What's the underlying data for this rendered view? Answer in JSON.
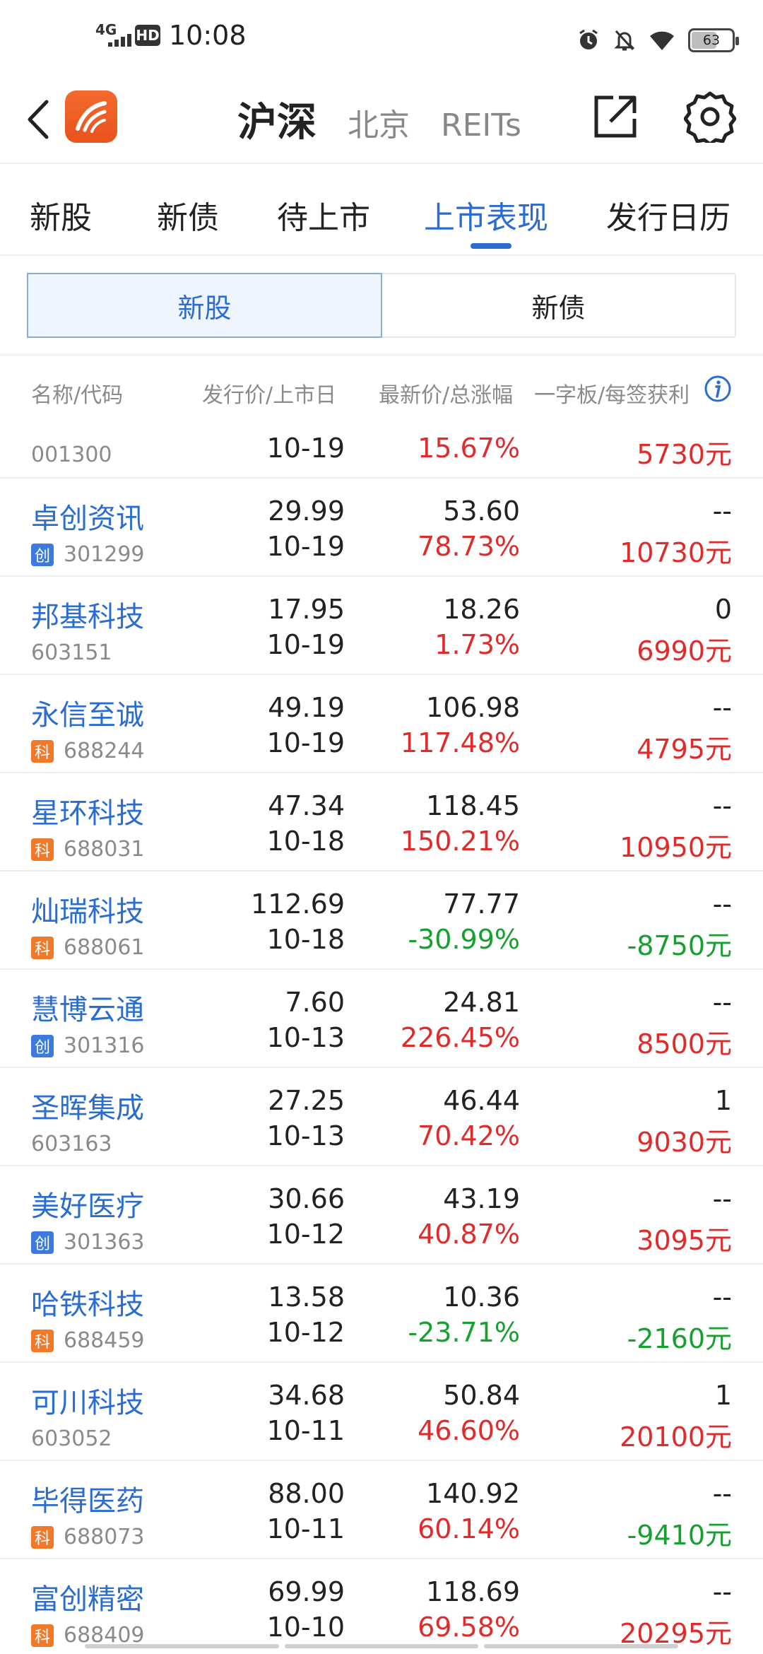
{
  "status": {
    "network": "4G",
    "hd": "HD",
    "time": "10:08",
    "battery": "63",
    "battery_level": 0.63
  },
  "header": {
    "market_tabs": [
      "沪深",
      "北京",
      "REITs"
    ],
    "active_market": 0
  },
  "section_tabs": [
    "新股",
    "新债",
    "待上市",
    "上市表现",
    "发行日历"
  ],
  "active_section": 3,
  "segment": [
    "新股",
    "新债"
  ],
  "columns": [
    "名称/代码",
    "发行价/上市日",
    "最新价/总涨幅",
    "一字板/每签获利"
  ],
  "partial_row": {
    "code": "001300",
    "date": "10-19",
    "change": "15.67%",
    "profit": "5730元"
  },
  "rows": [
    {
      "name": "卓创资讯",
      "badge": "创",
      "code": "301299",
      "issue_price": "29.99",
      "date": "10-19",
      "latest": "53.60",
      "change": "78.73%",
      "board": "--",
      "profit": "10730元",
      "trend": "up"
    },
    {
      "name": "邦基科技",
      "badge": "",
      "code": "603151",
      "issue_price": "17.95",
      "date": "10-19",
      "latest": "18.26",
      "change": "1.73%",
      "board": "0",
      "profit": "6990元",
      "trend": "up"
    },
    {
      "name": "永信至诚",
      "badge": "科",
      "code": "688244",
      "issue_price": "49.19",
      "date": "10-19",
      "latest": "106.98",
      "change": "117.48%",
      "board": "--",
      "profit": "4795元",
      "trend": "up"
    },
    {
      "name": "星环科技",
      "badge": "科",
      "code": "688031",
      "issue_price": "47.34",
      "date": "10-18",
      "latest": "118.45",
      "change": "150.21%",
      "board": "--",
      "profit": "10950元",
      "trend": "up"
    },
    {
      "name": "灿瑞科技",
      "badge": "科",
      "code": "688061",
      "issue_price": "112.69",
      "date": "10-18",
      "latest": "77.77",
      "change": "-30.99%",
      "board": "--",
      "profit": "-8750元",
      "trend": "down"
    },
    {
      "name": "慧博云通",
      "badge": "创",
      "code": "301316",
      "issue_price": "7.60",
      "date": "10-13",
      "latest": "24.81",
      "change": "226.45%",
      "board": "--",
      "profit": "8500元",
      "trend": "up"
    },
    {
      "name": "圣晖集成",
      "badge": "",
      "code": "603163",
      "issue_price": "27.25",
      "date": "10-13",
      "latest": "46.44",
      "change": "70.42%",
      "board": "1",
      "profit": "9030元",
      "trend": "up"
    },
    {
      "name": "美好医疗",
      "badge": "创",
      "code": "301363",
      "issue_price": "30.66",
      "date": "10-12",
      "latest": "43.19",
      "change": "40.87%",
      "board": "--",
      "profit": "3095元",
      "trend": "up"
    },
    {
      "name": "哈铁科技",
      "badge": "科",
      "code": "688459",
      "issue_price": "13.58",
      "date": "10-12",
      "latest": "10.36",
      "change": "-23.71%",
      "board": "--",
      "profit": "-2160元",
      "trend": "down"
    },
    {
      "name": "可川科技",
      "badge": "",
      "code": "603052",
      "issue_price": "34.68",
      "date": "10-11",
      "latest": "50.84",
      "change": "46.60%",
      "board": "1",
      "profit": "20100元",
      "trend": "up"
    },
    {
      "name": "毕得医药",
      "badge": "科",
      "code": "688073",
      "issue_price": "88.00",
      "date": "10-11",
      "latest": "140.92",
      "change": "60.14%",
      "board": "--",
      "profit": "-9410元",
      "trend": "mixed"
    },
    {
      "name": "富创精密",
      "badge": "科",
      "code": "688409",
      "issue_price": "69.99",
      "date": "10-10",
      "latest": "118.69",
      "change": "69.58%",
      "board": "--",
      "profit": "20295元",
      "trend": "up"
    }
  ],
  "colors": {
    "accent": "#2a6ccf",
    "up": "#e02b2b",
    "down": "#16a030",
    "badge_cy": "#3b7be0",
    "badge_ke": "#f07a2a"
  }
}
